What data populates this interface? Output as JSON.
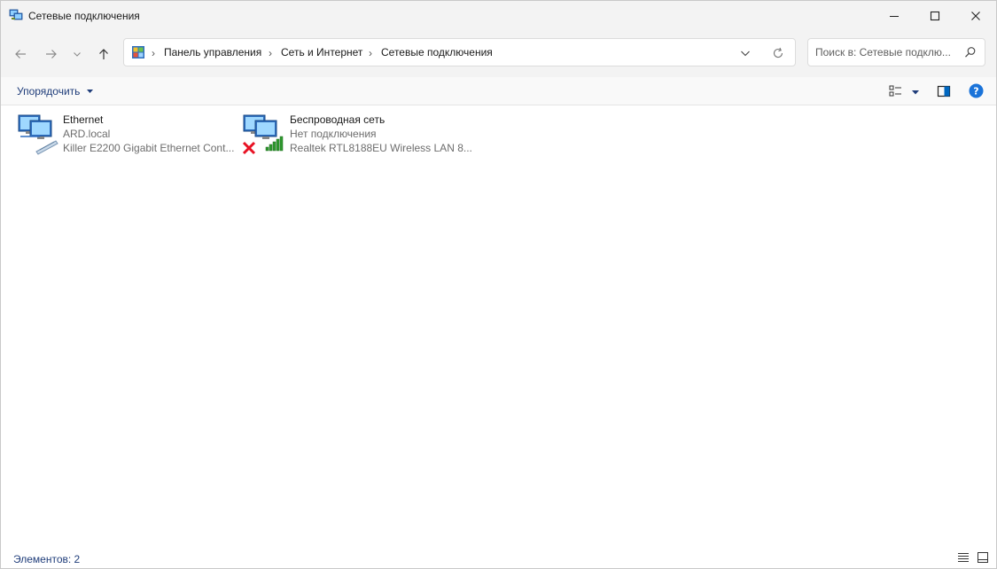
{
  "window": {
    "title": "Сетевые подключения"
  },
  "breadcrumb": [
    "Панель управления",
    "Сеть и Интернет",
    "Сетевые подключения"
  ],
  "search": {
    "placeholder": "Поиск в: Сетевые подклю..."
  },
  "toolbar": {
    "organize_label": "Упорядочить"
  },
  "connections": [
    {
      "name": "Ethernet",
      "status": "ARD.local",
      "device": "Killer E2200 Gigabit Ethernet Cont..."
    },
    {
      "name": "Беспроводная сеть",
      "status": "Нет подключения",
      "device": "Realtek RTL8188EU Wireless LAN 8..."
    }
  ],
  "statusbar": {
    "items_label": "Элементов: 2"
  },
  "colors": {
    "accent": "#0067c0",
    "link_text": "#1f3d7a",
    "error_red": "#e81123",
    "signal_green": "#2e9a2e"
  }
}
